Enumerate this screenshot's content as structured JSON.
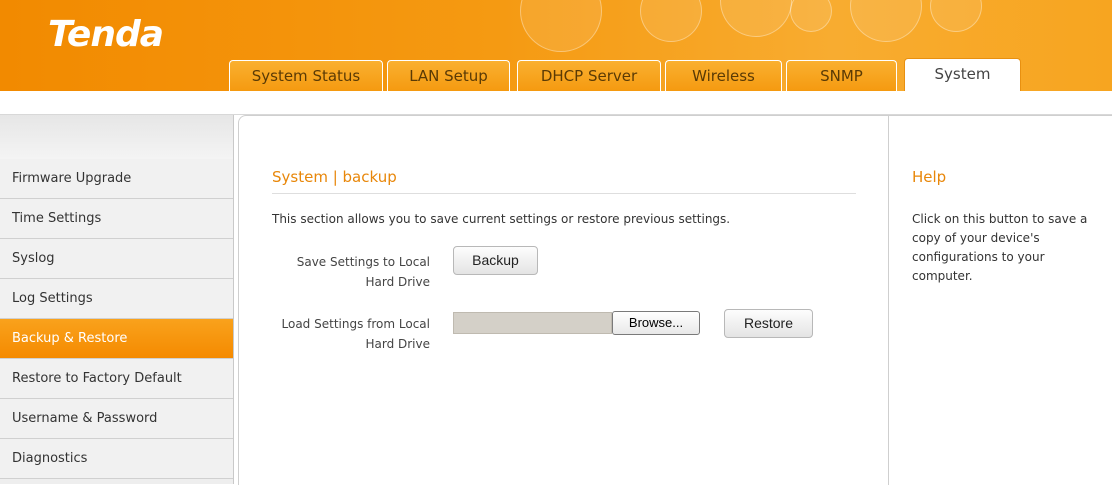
{
  "brand": {
    "logo": "Tenda"
  },
  "tabs": [
    {
      "label": "System Status"
    },
    {
      "label": "LAN Setup"
    },
    {
      "label": "DHCP Server"
    },
    {
      "label": "Wireless"
    },
    {
      "label": "SNMP"
    },
    {
      "label": "System",
      "active": true
    }
  ],
  "sidebar": {
    "items": [
      {
        "label": "Firmware Upgrade"
      },
      {
        "label": "Time Settings"
      },
      {
        "label": "Syslog"
      },
      {
        "label": "Log Settings"
      },
      {
        "label": "Backup & Restore",
        "active": true
      },
      {
        "label": "Restore to Factory Default"
      },
      {
        "label": "Username & Password"
      },
      {
        "label": "Diagnostics"
      }
    ]
  },
  "main": {
    "title": "System | backup",
    "description": "This section allows you to save current settings or restore previous settings.",
    "save_label_line1": "Save Settings to Local",
    "save_label_line2": "Hard Drive",
    "backup_button": "Backup",
    "load_label_line1": "Load Settings from Local",
    "load_label_line2": "Hard Drive",
    "file_value": "",
    "browse_button": "Browse...",
    "restore_button": "Restore"
  },
  "help": {
    "title": "Help",
    "text": "Click on this button to save a copy of your device's configurations to your computer."
  },
  "colors": {
    "accent": "#f59a10",
    "title_orange": "#e8870a"
  }
}
